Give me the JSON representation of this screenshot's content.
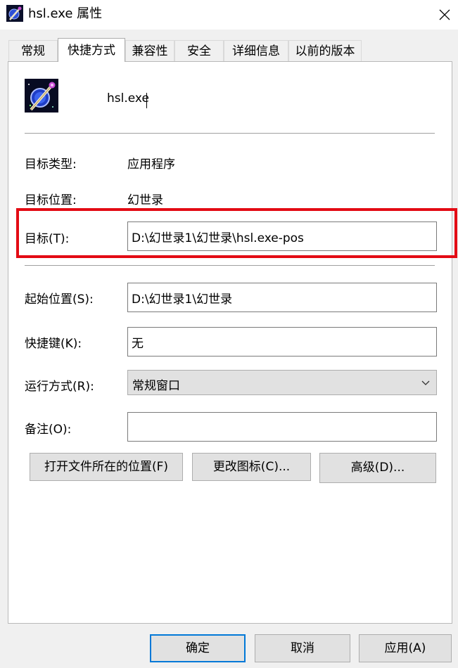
{
  "window": {
    "title": "hsl.exe 属性"
  },
  "tabs": [
    {
      "label": "常规"
    },
    {
      "label": "快捷方式",
      "active": true
    },
    {
      "label": "兼容性"
    },
    {
      "label": "安全"
    },
    {
      "label": "详细信息"
    },
    {
      "label": "以前的版本"
    }
  ],
  "shortcut": {
    "name": "hsl.exe",
    "target_type_label": "目标类型:",
    "target_type_value": "应用程序",
    "target_location_label": "目标位置:",
    "target_location_value": "幻世录",
    "target_label": "目标(T):",
    "target_value": "D:\\幻世录1\\幻世录\\hsl.exe-pos",
    "start_in_label": "起始位置(S):",
    "start_in_value": "D:\\幻世录1\\幻世录",
    "hotkey_label": "快捷键(K):",
    "hotkey_value": "无",
    "run_label": "运行方式(R):",
    "run_value": "常规窗口",
    "comment_label": "备注(O):",
    "comment_value": ""
  },
  "buttons": {
    "open_location": "打开文件所在的位置(F)",
    "change_icon": "更改图标(C)...",
    "advanced": "高级(D)..."
  },
  "footer": {
    "ok": "确定",
    "cancel": "取消",
    "apply": "应用(A)"
  },
  "colors": {
    "highlight": "#e30b14",
    "focus_border": "#0078d7"
  }
}
